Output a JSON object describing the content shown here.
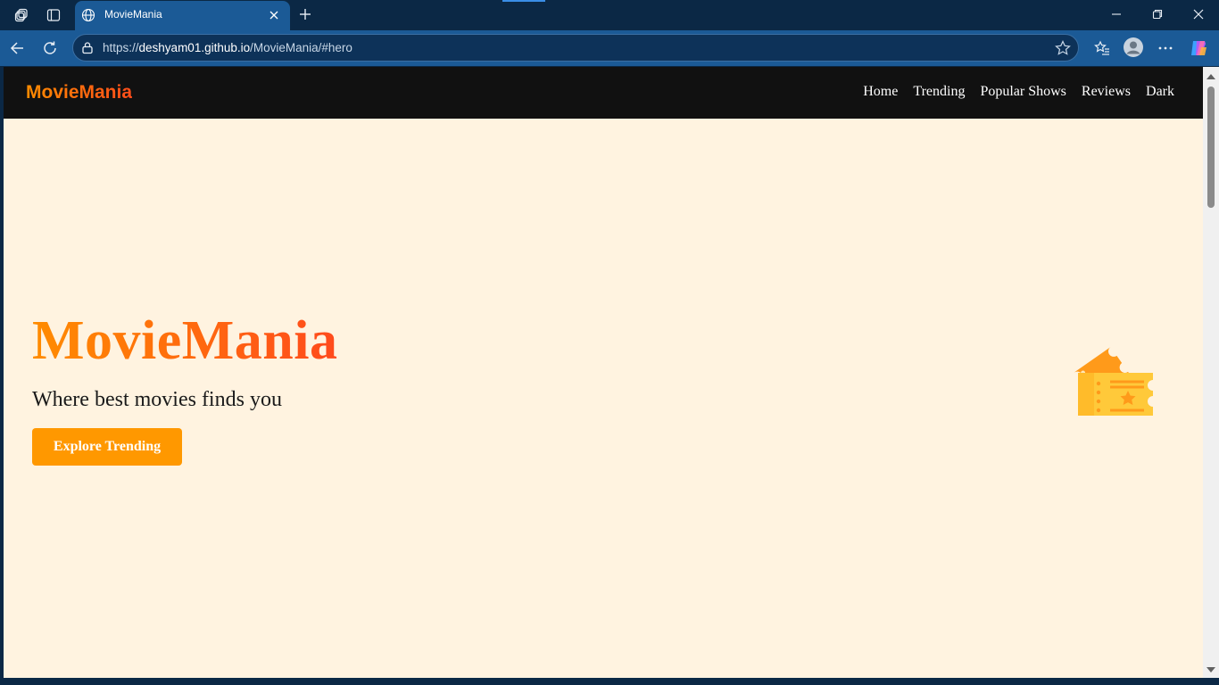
{
  "browser": {
    "tab_title": "MovieMania",
    "url_prefix": "https://",
    "url_host": "deshyam01.github.io",
    "url_path": "/MovieMania/#hero",
    "colors": {
      "frame": "#0b2845",
      "toolbar": "#1b5a96"
    }
  },
  "site": {
    "brand": "MovieMania",
    "nav": {
      "home": "Home",
      "trending": "Trending",
      "popular_shows": "Popular Shows",
      "reviews": "Reviews",
      "dark": "Dark"
    },
    "hero": {
      "title": "MovieMania",
      "subtitle": "Where best movies finds you",
      "button": "Explore Trending",
      "icon": "ticket-icon"
    },
    "colors": {
      "accent": "#ff9800",
      "accent_red": "#ff4a1c",
      "background": "#fff3e0",
      "navbar": "#111111"
    }
  }
}
